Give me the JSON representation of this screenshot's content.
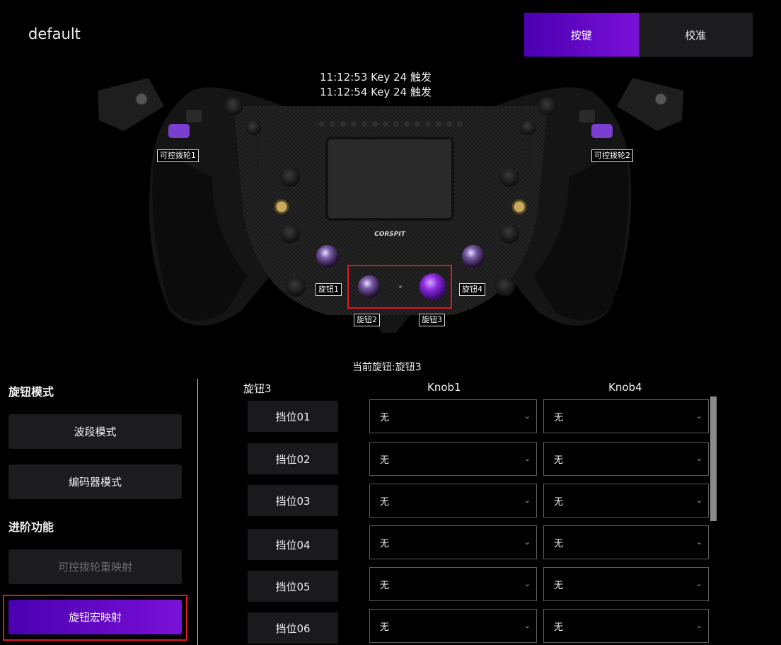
{
  "profile": {
    "name": "default"
  },
  "tabs": [
    {
      "label": "按键",
      "active": true
    },
    {
      "label": "校准",
      "active": false
    }
  ],
  "event_log": [
    "11:12:53  Key 24 触发",
    "11:12:54  Key 24 触发"
  ],
  "wheel": {
    "brand": "CORSPIT",
    "labels": {
      "paddle1": "可控拨轮1",
      "paddle2": "可控拨轮2",
      "knob1": "旋钮1",
      "knob2": "旋钮2",
      "knob3": "旋钮3",
      "knob4": "旋钮4"
    }
  },
  "current_knob": "当前旋钮:旋钮3",
  "left_panel": {
    "knob_mode_title": "旋钮模式",
    "band_mode": "波段模式",
    "encoder_mode": "编码器模式",
    "advanced_title": "进阶功能",
    "paddle_remap": "可控拨轮重映射",
    "knob_macro": "旋钮宏映射"
  },
  "grid": {
    "row_header": "旋钮3",
    "col1_header": "Knob1",
    "col2_header": "Knob4",
    "rows": [
      {
        "gear": "挡位01",
        "knob1": "无",
        "knob4": "无"
      },
      {
        "gear": "挡位02",
        "knob1": "无",
        "knob4": "无"
      },
      {
        "gear": "挡位03",
        "knob1": "无",
        "knob4": "无"
      },
      {
        "gear": "挡位04",
        "knob1": "无",
        "knob4": "无"
      },
      {
        "gear": "挡位05",
        "knob1": "无",
        "knob4": "无"
      },
      {
        "gear": "挡位06",
        "knob1": "无",
        "knob4": "无"
      }
    ]
  },
  "colors": {
    "accent_start": "#4a00b0",
    "accent_end": "#7a10d8",
    "highlight_red": "#e0181e",
    "knob_purple": "#8b2be0"
  },
  "icons": {
    "dropdown": "chevron-down-icon"
  }
}
